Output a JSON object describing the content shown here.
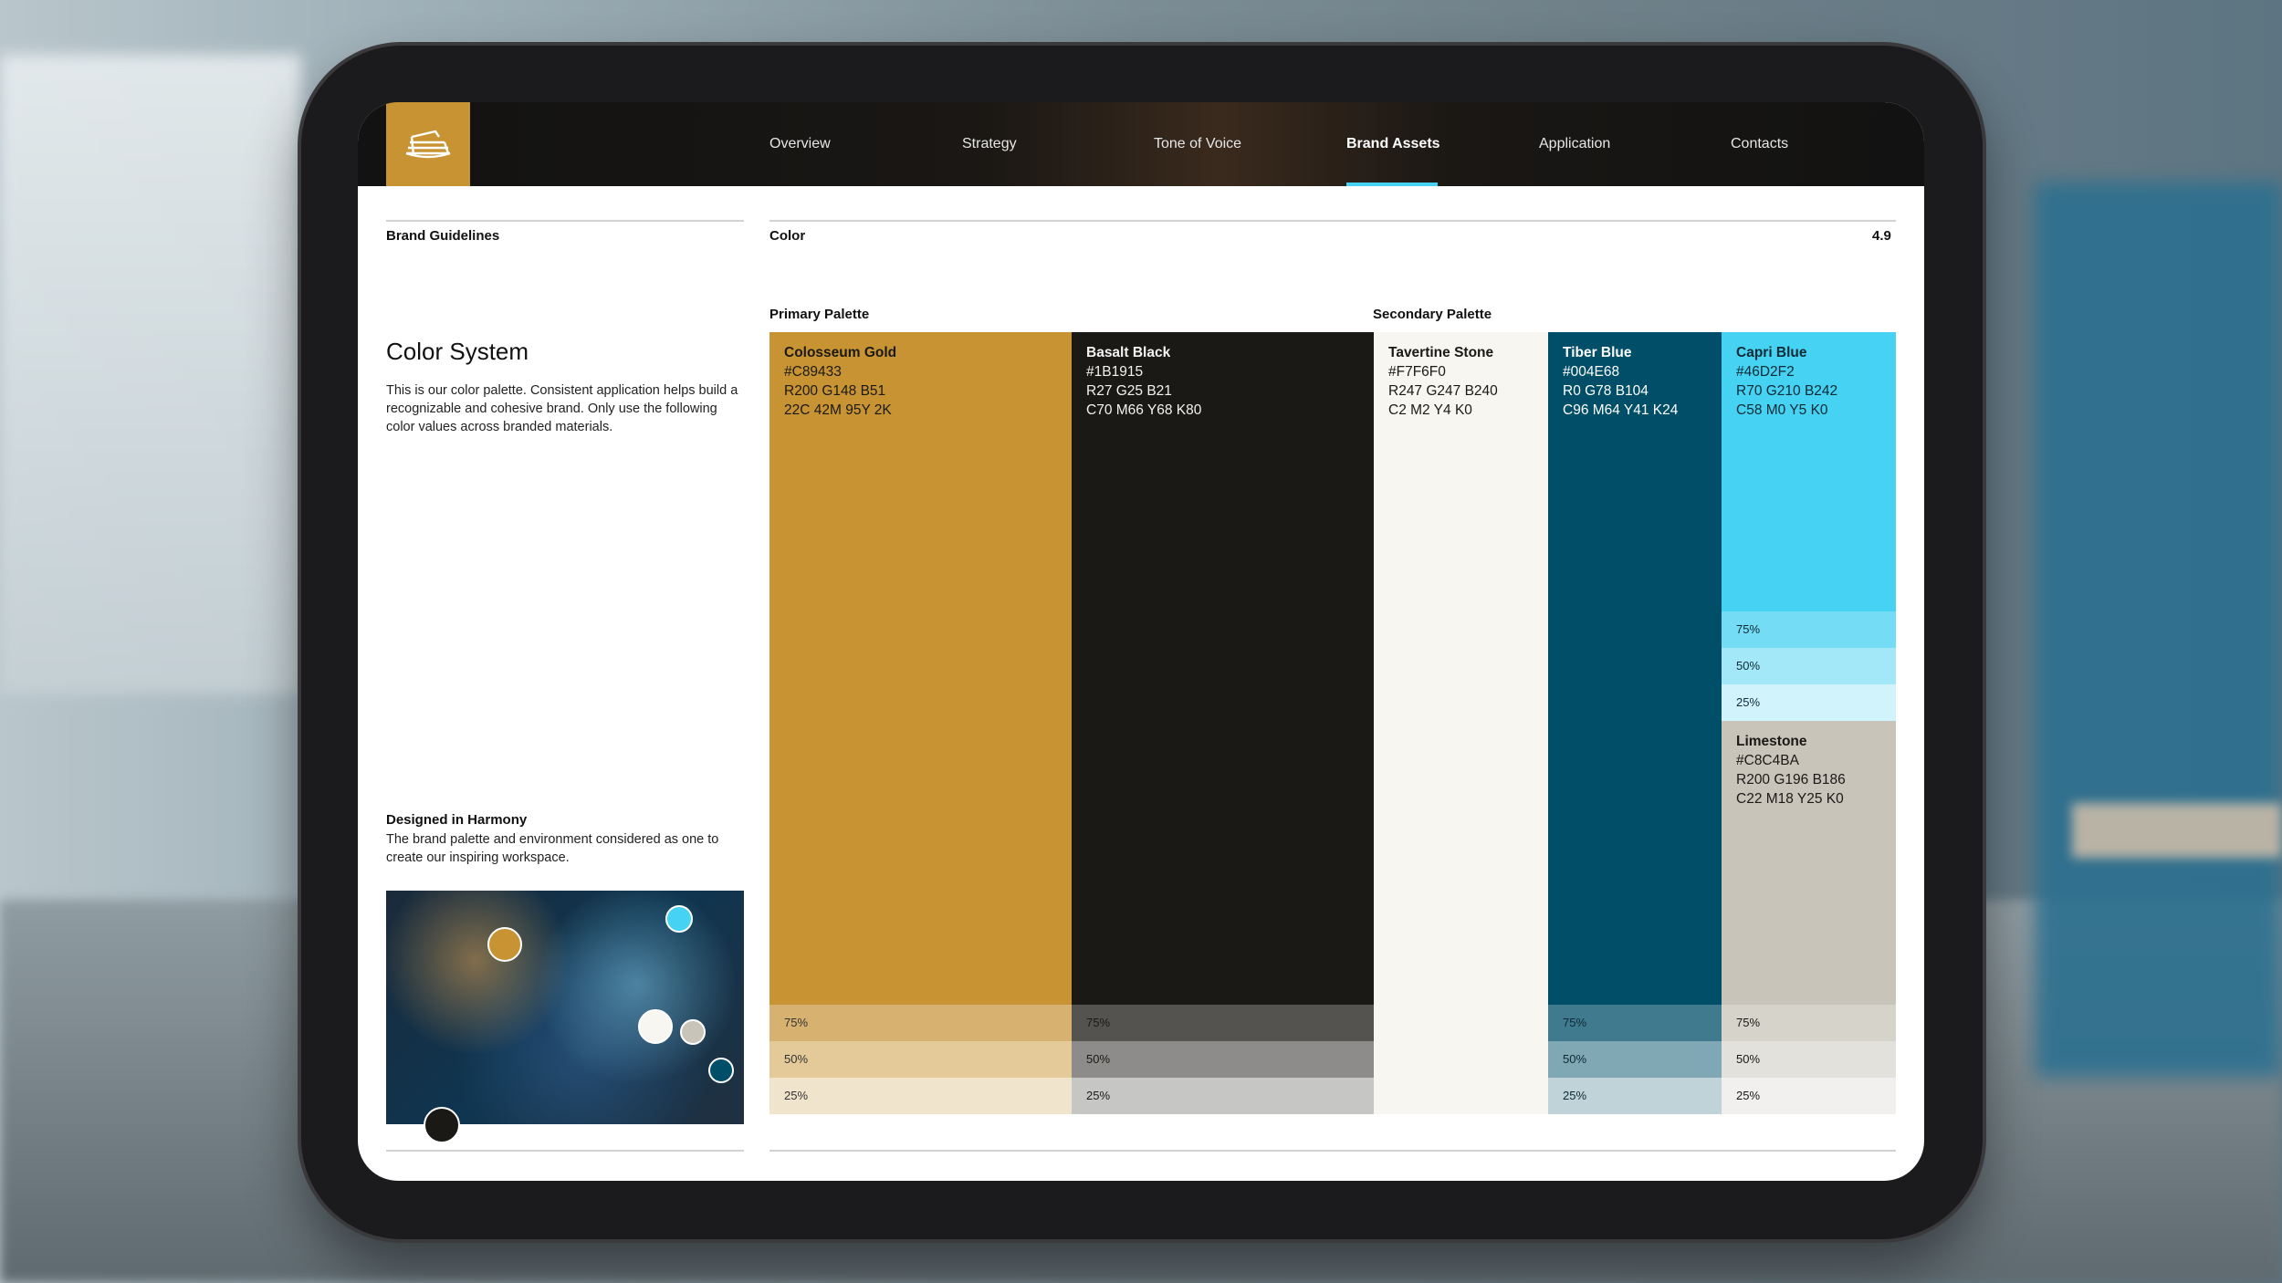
{
  "nav": {
    "items": [
      "Overview",
      "Strategy",
      "Tone of Voice",
      "Brand Assets",
      "Application",
      "Contacts"
    ],
    "active": "Brand Assets"
  },
  "sidebar": {
    "section_label": "Brand Guidelines",
    "title": "Color System",
    "intro": "This is our color palette. Consistent application helps build a recognizable and cohesive brand. Only use the following color values across branded materials.",
    "harmony_title": "Designed in Harmony",
    "harmony_text": "The brand palette and environment considered as one to create our inspiring workspace."
  },
  "main": {
    "section_label": "Color",
    "page_number": "4.9",
    "primary_label": "Primary Palette",
    "secondary_label": "Secondary Palette"
  },
  "colors": {
    "gold": {
      "name": "Colosseum Gold",
      "hex": "#C89433",
      "rgb": "R200  G148  B51",
      "cmyk": "22C  42M  95Y  2K"
    },
    "black": {
      "name": "Basalt Black",
      "hex": "#1B1915",
      "rgb": "R27  G25  B21",
      "cmyk": "C70  M66  Y68  K80"
    },
    "stone": {
      "name": "Tavertine Stone",
      "hex": "#F7F6F0",
      "rgb": "R247  G247  B240",
      "cmyk": "C2  M2  Y4  K0"
    },
    "tiber": {
      "name": "Tiber Blue",
      "hex": "#004E68",
      "rgb": "R0  G78  B104",
      "cmyk": "C96  M64  Y41  K24"
    },
    "capri": {
      "name": "Capri Blue",
      "hex": "#46D2F2",
      "rgb": "R70  G210  B242",
      "cmyk": "C58  M0  Y5  K0"
    },
    "limestone": {
      "name": "Limestone",
      "hex": "#C8C4BA",
      "rgb": "R200  G196  B186",
      "cmyk": "C22  M18  Y25  K0"
    }
  },
  "tints": {
    "t75": "75%",
    "t50": "50%",
    "t25": "25%"
  }
}
